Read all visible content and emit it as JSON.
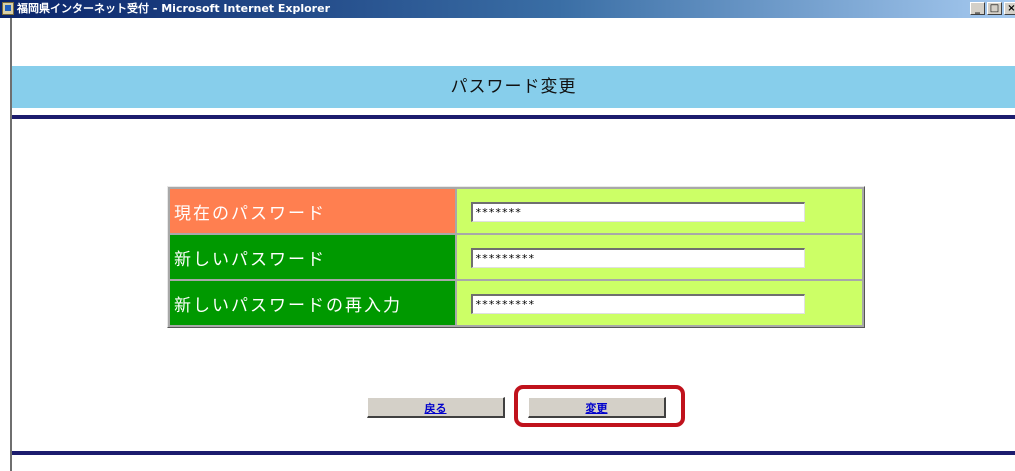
{
  "window": {
    "title": "福岡県インターネット受付 - Microsoft Internet Explorer",
    "minimize_glyph": "_",
    "maximize_glyph": "□",
    "close_glyph": "×"
  },
  "page": {
    "title": "パスワード変更"
  },
  "form": {
    "rows": [
      {
        "label": "現在のパスワード",
        "value": "*******"
      },
      {
        "label": "新しいパスワード",
        "value": "*********"
      },
      {
        "label": "新しいパスワードの再入力",
        "value": "*********"
      }
    ],
    "colors": {
      "current_label_bg": "#ff7f50",
      "new_label_bg": "#009900",
      "field_bg": "#ccff66",
      "header_band": "#87ceeb",
      "highlight": "#c0121c"
    }
  },
  "buttons": {
    "back_label": "戻る",
    "change_label": "変更"
  }
}
